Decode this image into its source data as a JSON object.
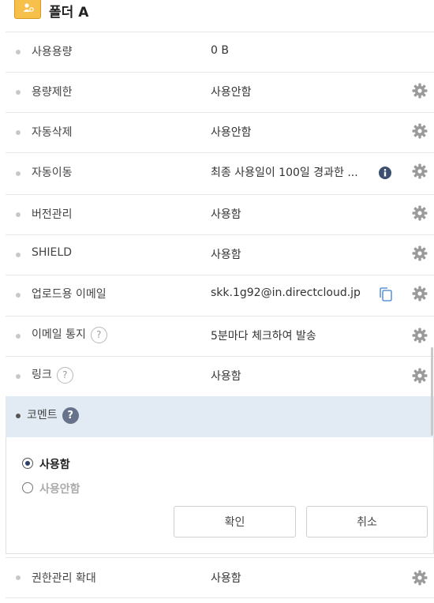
{
  "folder": {
    "title": "폴더 A",
    "icon": "folder-user-icon"
  },
  "rows": [
    {
      "label": "사용용량",
      "value": "0 B",
      "gear": false
    },
    {
      "label": "용량제한",
      "value": "사용안함",
      "gear": true
    },
    {
      "label": "자동삭제",
      "value": "사용안함",
      "gear": true
    },
    {
      "label": "자동이동",
      "value": "최종 사용일이 100일 경과한 ...",
      "gear": true,
      "info": true
    },
    {
      "label": "버전관리",
      "value": "사용함",
      "gear": true
    },
    {
      "label": "SHIELD",
      "value": "사용함",
      "gear": true
    },
    {
      "label": "업로드용 이메일",
      "value": "skk.1g92@in.directcloud.jp",
      "gear": true,
      "copy": true
    },
    {
      "label": "이메일 통지",
      "value": "5분마다 체크하여 발송",
      "gear": true,
      "help": "?"
    },
    {
      "label": "링크",
      "value": "사용함",
      "gear": true,
      "help": "?"
    }
  ],
  "comment": {
    "label": "코멘트",
    "help": "?",
    "options": [
      {
        "label": "사용함",
        "selected": true
      },
      {
        "label": "사용안함",
        "selected": false
      }
    ],
    "confirm_label": "확인",
    "cancel_label": "취소"
  },
  "last_row": {
    "label": "권한관리 확대",
    "value": "사용함",
    "gear": true
  },
  "colors": {
    "accent": "#67738a",
    "selected_bg": "#e2ebf3",
    "icon_gray": "#9a9a9a",
    "copy_blue": "#3f7fd0"
  }
}
